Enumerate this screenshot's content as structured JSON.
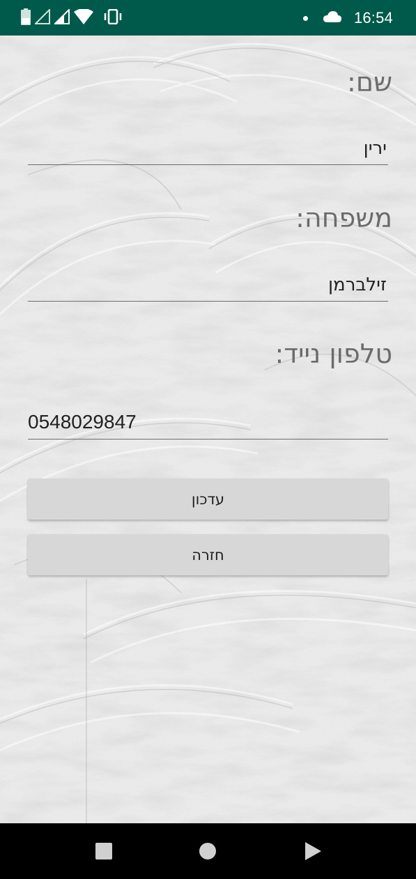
{
  "status_bar": {
    "time": "16:54",
    "background": "#005a4b",
    "icons": [
      "battery-icon",
      "signal-icon",
      "signal-icon",
      "wifi-icon",
      "vibrate-icon",
      "notification-dot-icon",
      "cloud-icon"
    ]
  },
  "form": {
    "first_name": {
      "label": "שם:",
      "value": "ירין"
    },
    "last_name": {
      "label": "משפחה:",
      "value": "זילברמן"
    },
    "mobile": {
      "label": "טלפון נייד:",
      "value": "0548029847"
    }
  },
  "buttons": {
    "update": "עדכון",
    "back": "חזרה"
  },
  "nav_bar": {
    "icons": [
      "recents-square-icon",
      "home-circle-icon",
      "back-triangle-icon"
    ]
  }
}
